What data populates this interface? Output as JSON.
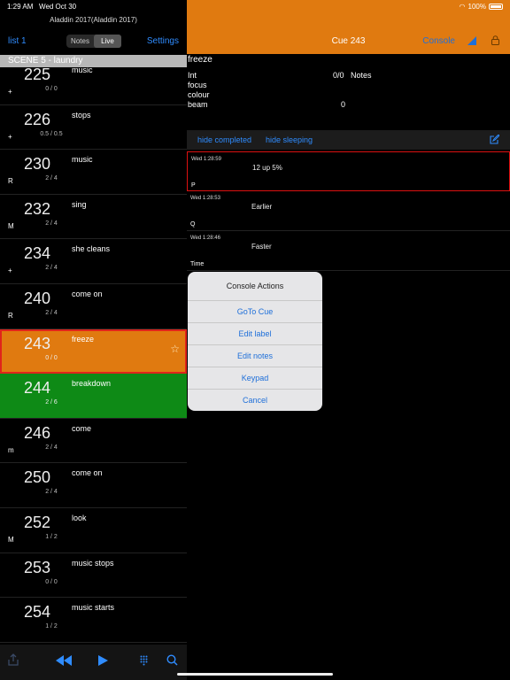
{
  "status": {
    "time": "1:29 AM",
    "date": "Wed Oct 30",
    "battery": "100%"
  },
  "left": {
    "app_title": "Aladdin 2017(Aladdin 2017)",
    "list_button": "list 1",
    "segments": [
      "Notes",
      "Live"
    ],
    "active_segment": "Live",
    "settings_button": "Settings",
    "scene_header": "SCENE 5 - laundry"
  },
  "cues": [
    {
      "num": "225",
      "label": "music",
      "count": "0 / 0",
      "mark": "+"
    },
    {
      "num": "226",
      "label": "stops",
      "count": "0.5 / 0.5",
      "mark": "+"
    },
    {
      "num": "230",
      "label": "music",
      "count": "2 / 4",
      "mark": "R"
    },
    {
      "num": "232",
      "label": "sing",
      "count": "2 / 4",
      "mark": "M"
    },
    {
      "num": "234",
      "label": "she cleans",
      "count": "2 / 4",
      "mark": "+"
    },
    {
      "num": "240",
      "label": "come on",
      "count": "2 / 4",
      "mark": "R"
    },
    {
      "num": "243",
      "label": "freeze",
      "count": "0 / 0",
      "mark": "",
      "state": "active"
    },
    {
      "num": "244",
      "label": "breakdown",
      "count": "2 / 6",
      "mark": "",
      "state": "next"
    },
    {
      "num": "246",
      "label": "come",
      "count": "2 / 4",
      "mark": "m"
    },
    {
      "num": "250",
      "label": "come on",
      "count": "2 / 4",
      "mark": ""
    },
    {
      "num": "252",
      "label": "look",
      "count": "1 / 2",
      "mark": "M"
    },
    {
      "num": "253",
      "label": "music stops",
      "count": "0 / 0",
      "mark": ""
    },
    {
      "num": "254",
      "label": "music starts",
      "count": "1 / 2",
      "mark": ""
    }
  ],
  "right": {
    "title": "Cue 243",
    "console_button": "Console",
    "details": {
      "label": "freeze",
      "int": "Int",
      "int_value": "0/0",
      "notes_label": "Notes",
      "focus": "focus",
      "colour": "colour",
      "beam": "beam",
      "beam_value": "0"
    },
    "filter": {
      "hide_completed": "hide completed",
      "hide_sleeping": "hide sleeping"
    },
    "notes": [
      {
        "timestamp": "Wed 1:28:59",
        "text": "12 up 5%",
        "initial": "P"
      },
      {
        "timestamp": "Wed 1:28:53",
        "text": "Earlier",
        "initial": "Q"
      },
      {
        "timestamp": "Wed 1:28:46",
        "text": "Faster",
        "initial": "Time"
      }
    ]
  },
  "sheet": {
    "title": "Console Actions",
    "options": [
      "GoTo Cue",
      "Edit label",
      "Edit notes",
      "Keypad",
      "Cancel"
    ]
  },
  "colors": {
    "accent": "#e07a10",
    "active_border": "#e0241b",
    "next": "#0e8a16",
    "link": "#2f8cff"
  }
}
